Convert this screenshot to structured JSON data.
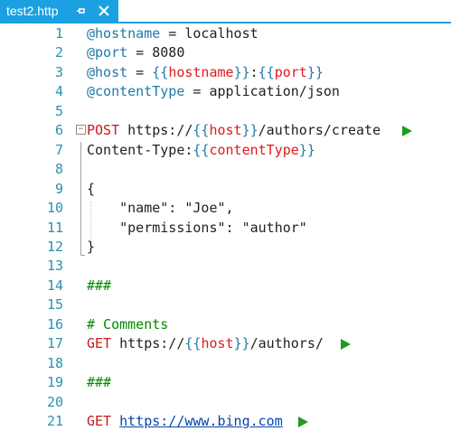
{
  "tab": {
    "title": "test2.http",
    "pin_icon": "pin-icon",
    "close_icon": "close-icon"
  },
  "colors": {
    "tab_accent": "#1ba1e2",
    "line_number": "#2b91af",
    "variable": "#1f7aa8",
    "variable_name": "#e01b1b",
    "comment": "#008a00",
    "run_arrow": "#1e9d1e"
  },
  "lines": [
    {
      "n": "1",
      "parts": [
        {
          "t": "@hostname",
          "c": "var"
        },
        {
          "t": " = localhost",
          "c": "plain"
        }
      ]
    },
    {
      "n": "2",
      "parts": [
        {
          "t": "@port",
          "c": "var"
        },
        {
          "t": " = 8080",
          "c": "plain"
        }
      ]
    },
    {
      "n": "3",
      "parts": [
        {
          "t": "@host",
          "c": "var"
        },
        {
          "t": " = ",
          "c": "plain"
        },
        {
          "t": "{{",
          "c": "brace"
        },
        {
          "t": "hostname",
          "c": "name"
        },
        {
          "t": "}}",
          "c": "brace"
        },
        {
          "t": ":",
          "c": "plain"
        },
        {
          "t": "{{",
          "c": "brace"
        },
        {
          "t": "port",
          "c": "name"
        },
        {
          "t": "}}",
          "c": "brace"
        }
      ]
    },
    {
      "n": "4",
      "parts": [
        {
          "t": "@contentType",
          "c": "var"
        },
        {
          "t": " = application/json",
          "c": "plain"
        }
      ]
    },
    {
      "n": "5",
      "parts": []
    },
    {
      "n": "6",
      "fold": true,
      "run": true,
      "parts": [
        {
          "t": "POST",
          "c": "method"
        },
        {
          "t": " https://",
          "c": "plain"
        },
        {
          "t": "{{",
          "c": "brace"
        },
        {
          "t": "host",
          "c": "name"
        },
        {
          "t": "}}",
          "c": "brace"
        },
        {
          "t": "/authors/create",
          "c": "plain"
        }
      ]
    },
    {
      "n": "7",
      "parts": [
        {
          "t": "Content-Type:",
          "c": "header"
        },
        {
          "t": "{{",
          "c": "brace"
        },
        {
          "t": "contentType",
          "c": "name"
        },
        {
          "t": "}}",
          "c": "brace"
        }
      ]
    },
    {
      "n": "8",
      "parts": []
    },
    {
      "n": "9",
      "parts": [
        {
          "t": "{",
          "c": "plain"
        }
      ]
    },
    {
      "n": "10",
      "parts": [
        {
          "t": "    \"name\": \"Joe\",",
          "c": "plain"
        }
      ]
    },
    {
      "n": "11",
      "parts": [
        {
          "t": "    \"permissions\": \"author\"",
          "c": "plain"
        }
      ]
    },
    {
      "n": "12",
      "parts": [
        {
          "t": "}",
          "c": "plain"
        }
      ]
    },
    {
      "n": "13",
      "parts": []
    },
    {
      "n": "14",
      "parts": [
        {
          "t": "###",
          "c": "sep"
        }
      ]
    },
    {
      "n": "15",
      "parts": []
    },
    {
      "n": "16",
      "parts": [
        {
          "t": "# Comments",
          "c": "comment"
        }
      ]
    },
    {
      "n": "17",
      "run": true,
      "parts": [
        {
          "t": "GET",
          "c": "method"
        },
        {
          "t": " https://",
          "c": "plain"
        },
        {
          "t": "{{",
          "c": "brace"
        },
        {
          "t": "host",
          "c": "name"
        },
        {
          "t": "}}",
          "c": "brace"
        },
        {
          "t": "/authors/",
          "c": "plain"
        }
      ]
    },
    {
      "n": "18",
      "parts": []
    },
    {
      "n": "19",
      "parts": [
        {
          "t": "###",
          "c": "sep"
        }
      ]
    },
    {
      "n": "20",
      "parts": []
    },
    {
      "n": "21",
      "run": true,
      "parts": [
        {
          "t": "GET",
          "c": "method"
        },
        {
          "t": " ",
          "c": "plain"
        },
        {
          "t": "https://www.bing.com",
          "c": "url-link"
        }
      ]
    }
  ]
}
